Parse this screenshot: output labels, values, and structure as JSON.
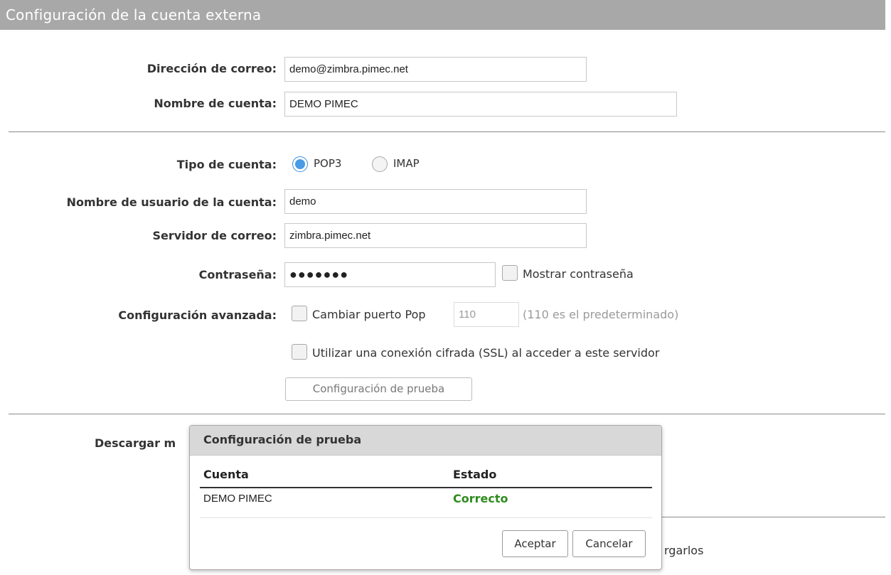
{
  "header": {
    "title": "Configuración de la cuenta externa"
  },
  "form": {
    "email_label": "Dirección de correo:",
    "email_value": "demo@zimbra.pimec.net",
    "account_name_label": "Nombre de cuenta:",
    "account_name_value": "DEMO PIMEC",
    "account_type_label": "Tipo de cuenta:",
    "account_type_options": [
      "POP3",
      "IMAP"
    ],
    "account_type_selected": "POP3",
    "username_label": "Nombre de usuario de la cuenta:",
    "username_value": "demo",
    "server_label": "Servidor de correo:",
    "server_value": "zimbra.pimec.net",
    "password_label": "Contraseña:",
    "password_value": "●●●●●●●",
    "show_password_label": "Mostrar contraseña",
    "advanced_label": "Configuración avanzada:",
    "change_port_label": "Cambiar puerto Pop",
    "port_value": "110",
    "port_hint": "(110 es el predeterminado)",
    "ssl_label": "Utilizar una conexión cifrada (SSL) al acceder a este servidor",
    "test_button": "Configuración de prueba",
    "download_label_partial": "Descargar m",
    "download_trailing_partial": "rgarlos"
  },
  "dialog": {
    "title": "Configuración de prueba",
    "columns": [
      "Cuenta",
      "Estado"
    ],
    "rows": [
      {
        "account": "DEMO PIMEC",
        "status": "Correcto"
      }
    ],
    "ok_button": "Aceptar",
    "cancel_button": "Cancelar",
    "status_color": "#2e8b1e"
  }
}
